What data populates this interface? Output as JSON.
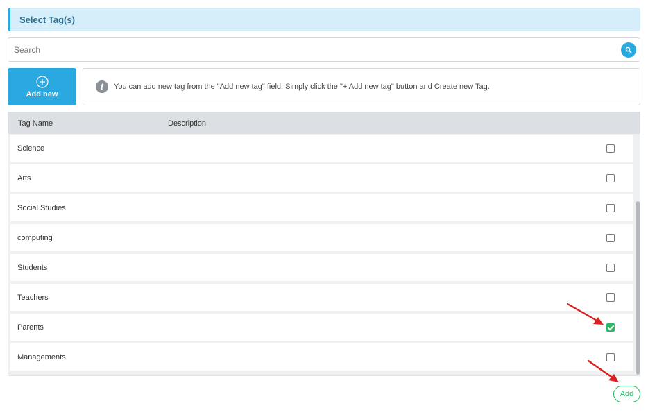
{
  "header": {
    "title": "Select Tag(s)"
  },
  "search": {
    "placeholder": "Search",
    "value": ""
  },
  "add_new": {
    "label": "Add new"
  },
  "info": {
    "text": "You can add new tag from the \"Add new tag\" field. Simply click the \"+ Add new tag\" button and Create new Tag."
  },
  "table": {
    "columns": {
      "name": "Tag Name",
      "description": "Description"
    },
    "rows": [
      {
        "name": "Science",
        "description": "",
        "checked": false
      },
      {
        "name": "Arts",
        "description": "",
        "checked": false
      },
      {
        "name": "Social Studies",
        "description": "",
        "checked": false
      },
      {
        "name": "computing",
        "description": "",
        "checked": false
      },
      {
        "name": "Students",
        "description": "",
        "checked": false
      },
      {
        "name": "Teachers",
        "description": "",
        "checked": false
      },
      {
        "name": "Parents",
        "description": "",
        "checked": true
      },
      {
        "name": "Managements",
        "description": "",
        "checked": false
      }
    ]
  },
  "footer": {
    "add_label": "Add"
  },
  "colors": {
    "accent": "#29a9e0",
    "success": "#29b765",
    "annotation": "#d9201f"
  }
}
